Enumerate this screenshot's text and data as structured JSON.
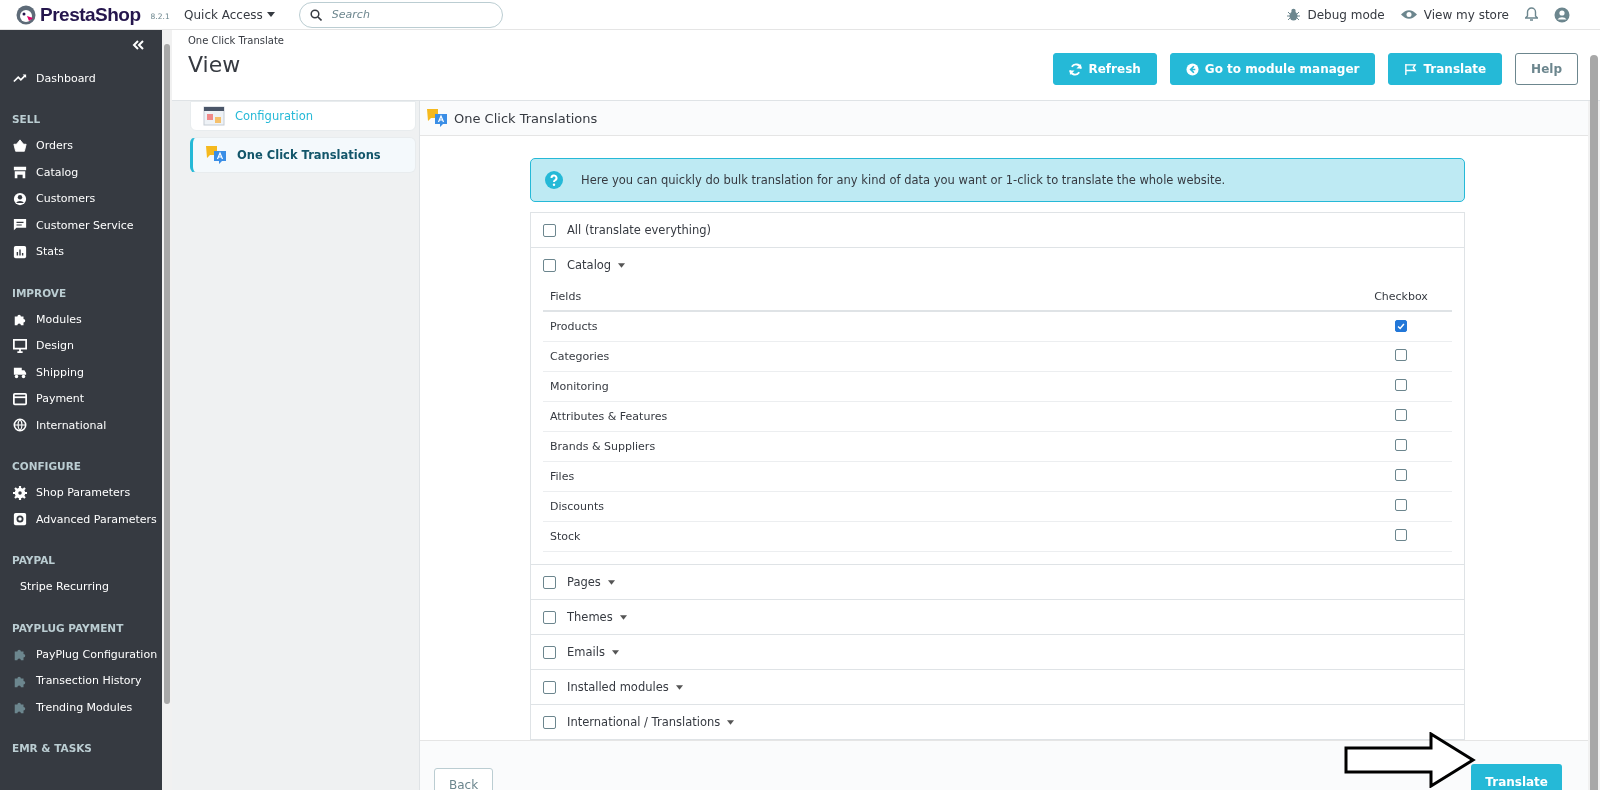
{
  "topbar": {
    "brand": "PrestaShop",
    "version": "8.2.1",
    "quick_access": "Quick Access",
    "search": {
      "placeholder": "Search"
    },
    "links": [
      {
        "label": "Debug mode"
      },
      {
        "label": "View my store"
      }
    ]
  },
  "sidebar": {
    "top_item": "Dashboard",
    "groups": [
      {
        "title": "SELL",
        "items": [
          "Orders",
          "Catalog",
          "Customers",
          "Customer Service",
          "Stats"
        ]
      },
      {
        "title": "IMPROVE",
        "items": [
          "Modules",
          "Design",
          "Shipping",
          "Payment",
          "International"
        ]
      },
      {
        "title": "CONFIGURE",
        "items": [
          "Shop Parameters",
          "Advanced Parameters"
        ]
      },
      {
        "title": "PAYPAL",
        "items": [
          "Stripe Recurring"
        ]
      },
      {
        "title": "PAYPLUG PAYMENT",
        "items": [
          "PayPlug Configuration",
          "Transection History",
          "Trending Modules"
        ]
      },
      {
        "title": "EMR & TASKS"
      }
    ]
  },
  "header": {
    "breadcrumb": "One Click Translate",
    "title": "View",
    "buttons": [
      {
        "label": "Refresh",
        "kind": "primary"
      },
      {
        "label": "Go to module manager",
        "kind": "primary"
      },
      {
        "label": "Translate",
        "kind": "primary"
      },
      {
        "label": "Help",
        "kind": "outline"
      }
    ]
  },
  "module_tabs": [
    {
      "label": "Configuration",
      "selected": false
    },
    {
      "label": "One Click Translations",
      "selected": true
    }
  ],
  "panel": {
    "title": "One Click Translations",
    "alert": "Here you can quickly do bulk translation for any kind of data you want or 1-click to translate the whole website.",
    "sections": [
      {
        "label": "All (translate everything)",
        "checked": false,
        "kind": "plain"
      },
      {
        "label": "Catalog",
        "checked": false,
        "kind": "dropdown",
        "columns": [
          "Fields",
          "Checkbox"
        ],
        "rows": [
          {
            "label": "Products",
            "checked": true
          },
          {
            "label": "Categories",
            "checked": false
          },
          {
            "label": "Monitoring",
            "checked": false
          },
          {
            "label": "Attributes & Features",
            "checked": false
          },
          {
            "label": "Brands & Suppliers",
            "checked": false
          },
          {
            "label": "Files",
            "checked": false
          },
          {
            "label": "Discounts",
            "checked": false
          },
          {
            "label": "Stock",
            "checked": false
          }
        ]
      },
      {
        "label": "Pages",
        "checked": false,
        "kind": "dropdown"
      },
      {
        "label": "Themes",
        "checked": false,
        "kind": "dropdown"
      },
      {
        "label": "Emails",
        "checked": false,
        "kind": "dropdown"
      },
      {
        "label": "Installed modules",
        "checked": false,
        "kind": "dropdown"
      },
      {
        "label": "International / Translations",
        "checked": false,
        "kind": "dropdown"
      }
    ],
    "footer": {
      "back": "Back",
      "submit": "Translate"
    }
  }
}
